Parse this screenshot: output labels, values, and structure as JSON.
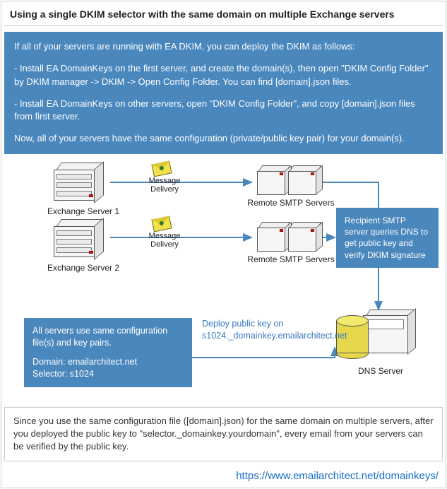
{
  "title": "Using a single DKIM selector with the same domain on multiple Exchange servers",
  "intro": {
    "p1": "If all of your servers are running with EA DKIM, you can deploy the DKIM as follows:",
    "p2": "-  Install EA DomainKeys on the first server, and create the domain(s), then open \"DKIM Config Folder\" by DKIM manager -> DKIM -> Open Config Folder. You can find [domain].json files.",
    "p3": "- Install EA DomainKeys on other servers, open \"DKIM Config Folder\", and copy [domain].json files from first server.",
    "p4": "Now, all of your servers have the same configuration (private/public key pair) for your domain(s)."
  },
  "diagram": {
    "exchange1": "Exchange Server 1",
    "exchange2": "Exchange Server 2",
    "msg_delivery": "Message\nDelivery",
    "remote_smtp": "Remote SMTP Servers",
    "dns_server": "DNS Server",
    "callout_right": "Recipient SMTP server queries DNS to get public key and verify DKIM signature",
    "callout_left_l1": "All servers use same configuration file(s) and key pairs.",
    "callout_left_l2": "Domain: emailarchitect.net",
    "callout_left_l3": "Selector: s1024",
    "deploy_l1": "Deploy public key on",
    "deploy_l2": "s1024._domainkey.emailarchitect.net"
  },
  "footer_note": "Since you use the same configuration file ([domain].json) for the same domain on multiple servers, after you deployed the public key to \"selector._domainkey.yourdomain\", every email from your servers can be verified by the public key.",
  "link": "https://www.emailarchitect.net/domainkeys/"
}
